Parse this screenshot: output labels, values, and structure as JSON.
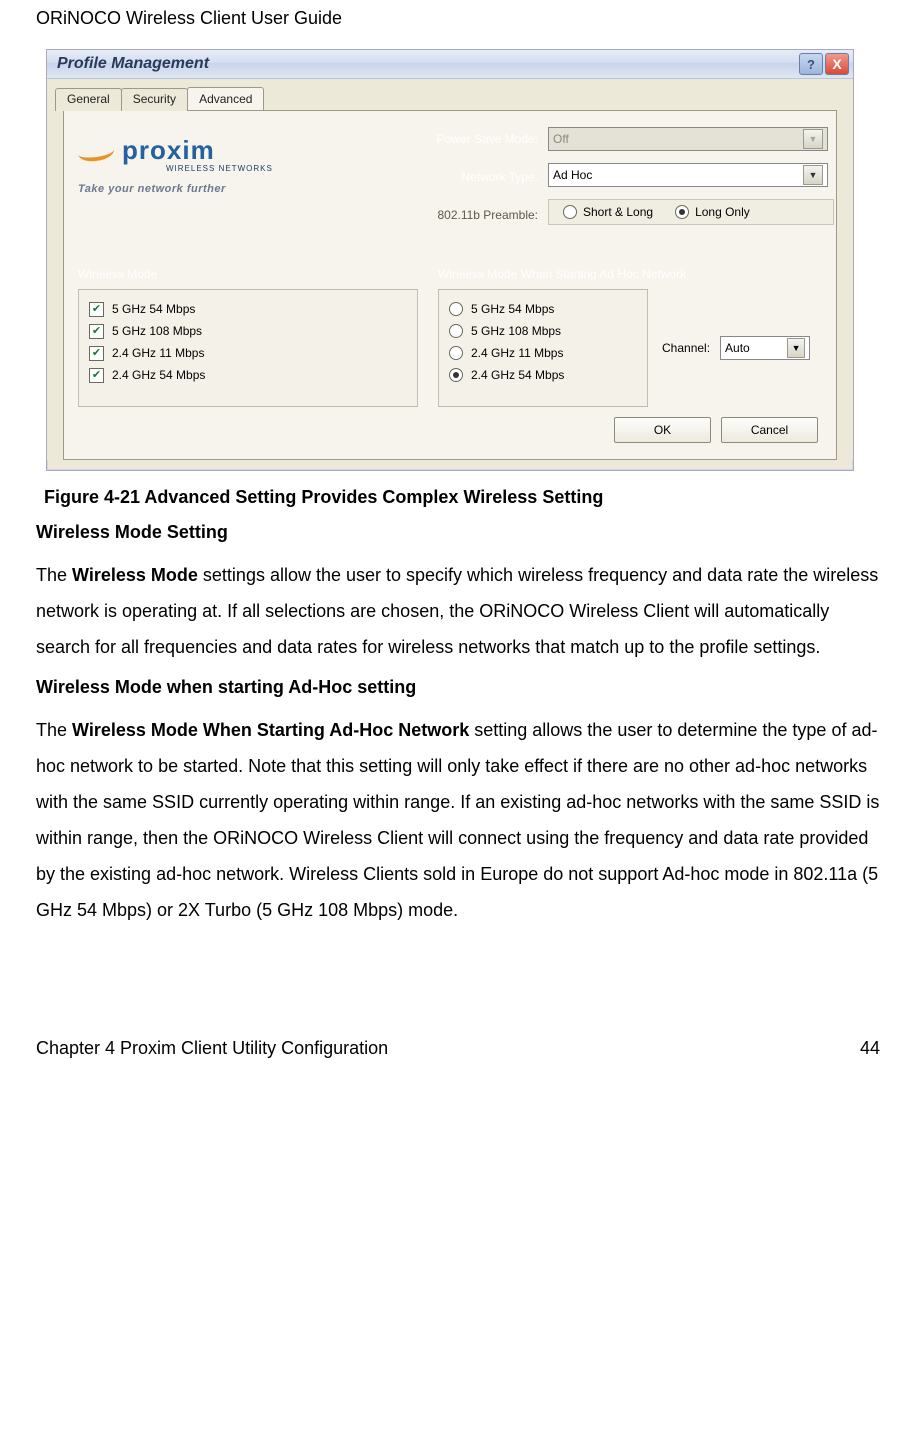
{
  "header": "ORiNOCO Wireless Client User Guide",
  "dialog": {
    "title": "Profile Management",
    "help_glyph": "?",
    "close_glyph": "X",
    "tabs": {
      "general": "General",
      "security": "Security",
      "advanced": "Advanced"
    },
    "logo": {
      "brand": "proxim",
      "sub": "WIRELESS NETWORKS",
      "tagline": "Take your network further"
    },
    "fields": {
      "power_save": {
        "label": "Power Save Mode:",
        "value": "Off"
      },
      "network_type": {
        "label": "Network Type:",
        "value": "Ad Hoc"
      },
      "preamble": {
        "label": "802.11b Preamble:",
        "opts": {
          "short_long": "Short & Long",
          "long_only": "Long Only"
        }
      }
    },
    "wm": {
      "left_header": "Wireless Mode",
      "right_header": "Wireless Mode When Starting Ad Hoc Network",
      "opts": {
        "o1": "5 GHz 54 Mbps",
        "o2": "5 GHz 108 Mbps",
        "o3": "2.4 GHz 11 Mbps",
        "o4": "2.4 GHz 54 Mbps"
      },
      "channel_label": "Channel:",
      "channel_value": "Auto"
    },
    "buttons": {
      "ok": "OK",
      "cancel": "Cancel"
    }
  },
  "caption": "Figure 4-21  Advanced Setting Provides Complex Wireless Setting",
  "s1_title": "Wireless Mode Setting",
  "s1_pre": "The ",
  "s1_bold": "Wireless Mode",
  "s1_post": " settings allow the user to specify which wireless frequency and data rate the wireless network is operating at. If all selections are chosen, the ORiNOCO Wireless Client will automatically search for all frequencies and data rates for wireless networks that match up to the profile settings.",
  "s2_title": "Wireless Mode when starting Ad-Hoc setting",
  "s2_pre": "The ",
  "s2_bold": "Wireless Mode When Starting Ad-Hoc Network",
  "s2_post": " setting allows the user to determine the type of ad-hoc network to be started. Note that this setting will only take effect if there are no other ad-hoc networks with the same SSID currently operating within range. If an existing ad-hoc networks with the same SSID is within range, then the ORiNOCO Wireless Client will connect using the frequency and data rate provided by the existing ad-hoc network. Wireless Clients sold in Europe do not support Ad-hoc mode in 802.11a (5 GHz 54 Mbps) or 2X Turbo (5 GHz 108 Mbps) mode.",
  "footer": {
    "chapter": "Chapter 4 Proxim Client Utility Configuration",
    "page": "44"
  }
}
